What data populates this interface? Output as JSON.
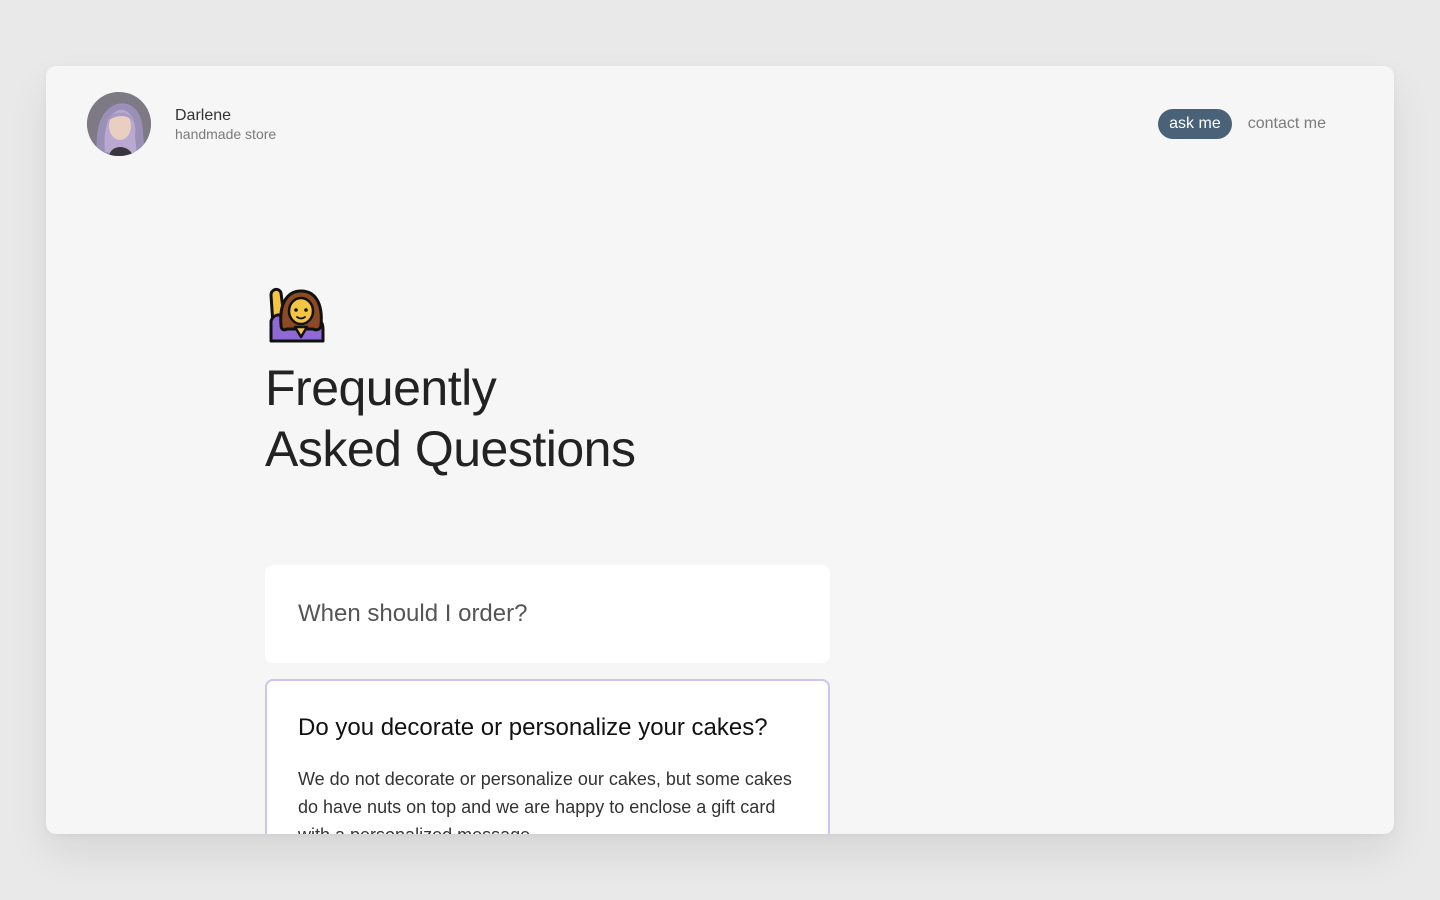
{
  "header": {
    "name": "Darlene",
    "subtitle": "handmade store"
  },
  "nav": {
    "ask_label": "ask me",
    "contact_label": "contact me"
  },
  "hero": {
    "emoji_icon": "person-raising-hand-icon",
    "title_line1": "Frequently",
    "title_line2": "Asked Questions"
  },
  "faq": [
    {
      "question": "When should I order?",
      "expanded": false
    },
    {
      "question": "Do you decorate or personalize your cakes?",
      "answer": "We do not decorate or personalize our cakes, but some cakes do have nuts on top and we are happy to enclose a gift card with a personalized message.",
      "expanded": true
    }
  ],
  "colors": {
    "accent": "#4a6278",
    "active_border": "#c9c6f0",
    "page_bg": "#f6f6f6"
  }
}
